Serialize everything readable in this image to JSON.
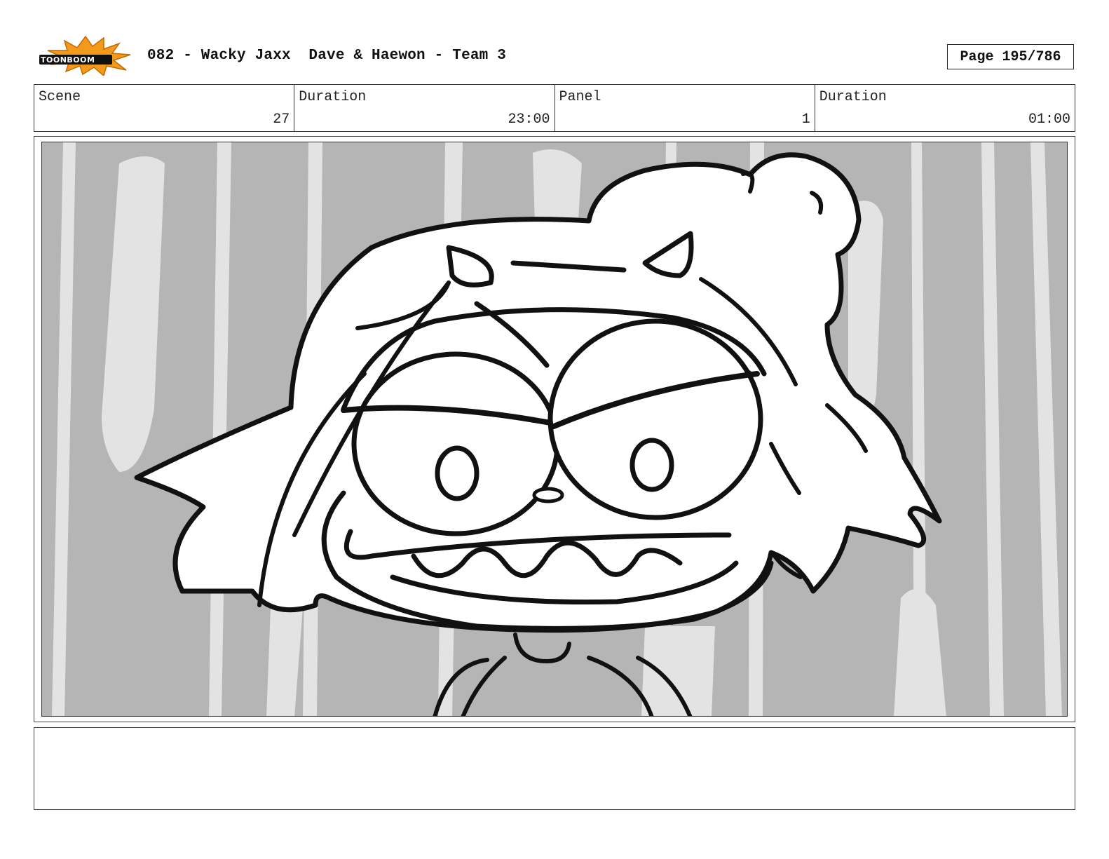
{
  "header": {
    "logo_text": "TOONBOOM",
    "title": "082 - Wacky Jaxx  Dave & Haewon - Team 3",
    "page": "Page 195/786"
  },
  "info": [
    {
      "label": "Scene",
      "value": "27"
    },
    {
      "label": "Duration",
      "value": "23:00"
    },
    {
      "label": "Panel",
      "value": "1"
    },
    {
      "label": "Duration",
      "value": "01:00"
    }
  ],
  "notes": {
    "text": ""
  },
  "colors": {
    "logo_orange": "#f39a1c",
    "panel_gray": "#b5b5b5",
    "streak_light": "#e3e3e3"
  }
}
